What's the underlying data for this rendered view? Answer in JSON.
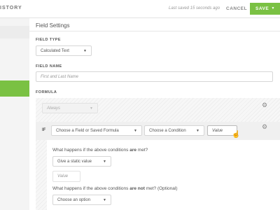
{
  "topbar": {
    "title_fragment": "ISTORY",
    "last_saved": "Last saved 15 seconds ago",
    "cancel_label": "CANCEL",
    "save_label": "SAVE"
  },
  "panel": {
    "title": "Field Settings",
    "field_type": {
      "label": "FIELD TYPE",
      "value": "Calculated Text"
    },
    "field_name": {
      "label": "FIELD NAME",
      "placeholder": "First and Last Name"
    },
    "formula": {
      "label": "FORMULA",
      "always_value": "Always",
      "if_label": "IF",
      "field_select": "Choose a Field or Saved Formula",
      "condition_select": "Choose a Condition",
      "value_input": "Value",
      "met_question": {
        "prefix": "What happens if the above conditions ",
        "emph": "are",
        "suffix": " met?"
      },
      "met_action": "Give a static value",
      "met_value_placeholder": "Value",
      "not_met_question": {
        "prefix": "What happens if the above conditions ",
        "emph": "are not",
        "suffix": " met? (Optional)"
      },
      "not_met_action": "Choose an option"
    }
  },
  "icons": {
    "gear": "gear-icon",
    "caret": "chevron-down-icon",
    "cursor": "hand-pointer-icon"
  },
  "colors": {
    "accent": "#7ac143"
  }
}
